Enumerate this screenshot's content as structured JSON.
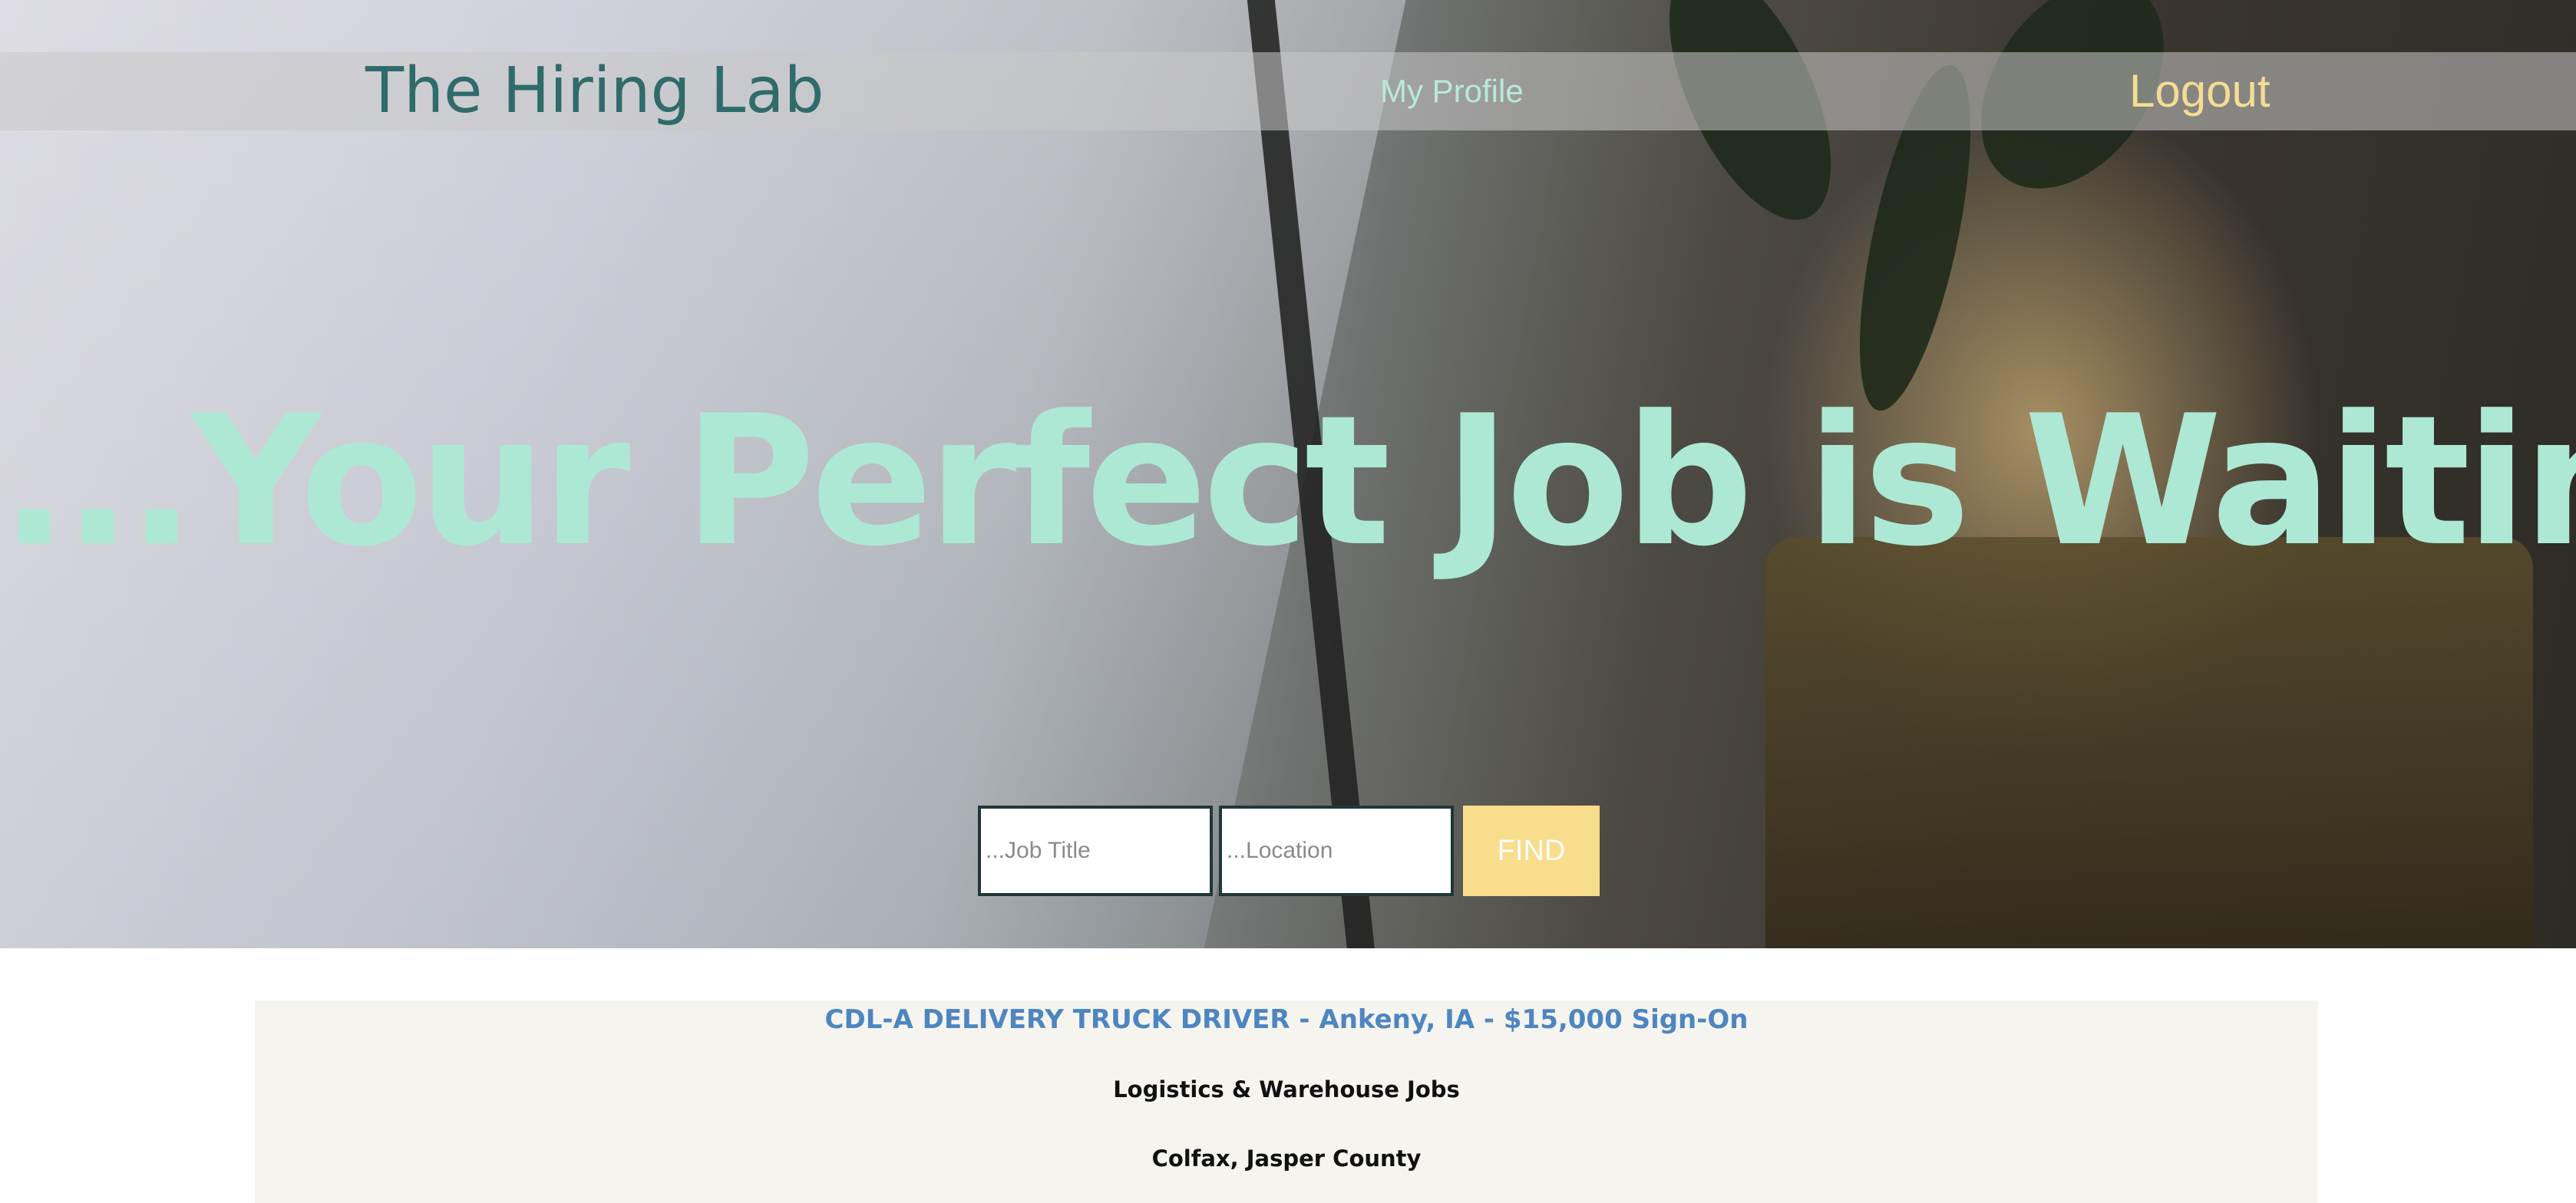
{
  "nav": {
    "brand": "The Hiring Lab",
    "profile_label": "My Profile",
    "logout_label": "Logout"
  },
  "hero": {
    "headline": "...Your Perfect Job is Waiting"
  },
  "search": {
    "title_placeholder": "...Job Title",
    "location_placeholder": "...Location",
    "find_label": "FIND"
  },
  "jobs": [
    {
      "title": "CDL-A DELIVERY TRUCK DRIVER - Ankeny, IA - $15,000 Sign-On",
      "category": "Logistics & Warehouse Jobs",
      "location": "Colfax, Jasper County"
    }
  ],
  "colors": {
    "brand": "#2f6b6b",
    "headline": "#ade8d4",
    "logout": "#f4dc92",
    "profile": "#b9e9d9",
    "find_button": "#f8dd8c",
    "job_title": "#4d86c0",
    "card_background": "#f6f4ef"
  }
}
